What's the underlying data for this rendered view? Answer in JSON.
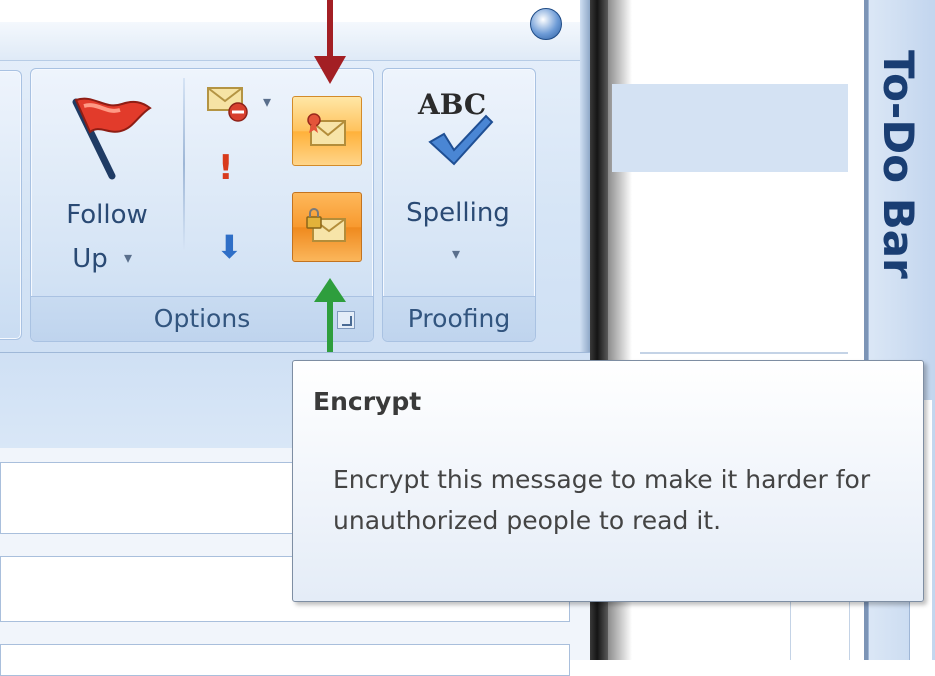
{
  "ribbon": {
    "options_group": {
      "label": "Options",
      "follow_up": {
        "label_line1": "Follow",
        "label_line2": "Up",
        "dropdown": "▾"
      },
      "dropdown_small": "▾",
      "importance_high": "!",
      "importance_low": "⬇"
    },
    "proofing_group": {
      "label": "Proofing",
      "spelling": {
        "icon_text": "ABC",
        "label": "Spelling",
        "dropdown": "▾"
      }
    }
  },
  "todo_bar": {
    "label": "To-Do Bar"
  },
  "tooltip": {
    "title": "Encrypt",
    "body": "Encrypt this message to make it harder for unauthorized people to read it."
  },
  "colors": {
    "arrow_top": "#a31f24",
    "arrow_bottom": "#2e9e3d",
    "accent_orange": "#ffb13a",
    "tooltip_border": "#7e8ea3"
  }
}
